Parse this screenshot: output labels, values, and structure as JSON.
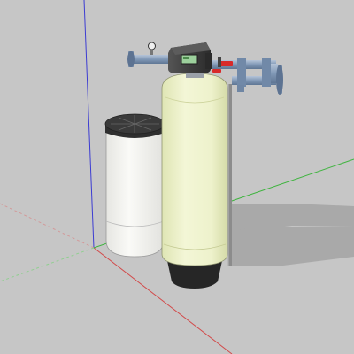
{
  "scene": {
    "background": "#c6c6c6",
    "shadow_color": "#a9a9a9",
    "axes": {
      "red_axis": "#d24a4a",
      "green_axis": "#3fb43f",
      "blue_axis": "#3c3cd2"
    },
    "objects": {
      "softener_tank": {
        "icon": "resin-tank-icon",
        "body_color": "#eef2cc",
        "base_color": "#262626"
      },
      "brine_tank": {
        "icon": "brine-tank-icon",
        "body_color": "#f4f4f0",
        "lid_color": "#3a3a3a"
      },
      "control_valve": {
        "icon": "control-valve-icon",
        "color": "#3e3e3e",
        "display_color": "#9cd09c"
      },
      "piping": {
        "icon": "pipe-icon",
        "color": "#7f97b6",
        "handle_color": "#d82a2a"
      }
    }
  }
}
